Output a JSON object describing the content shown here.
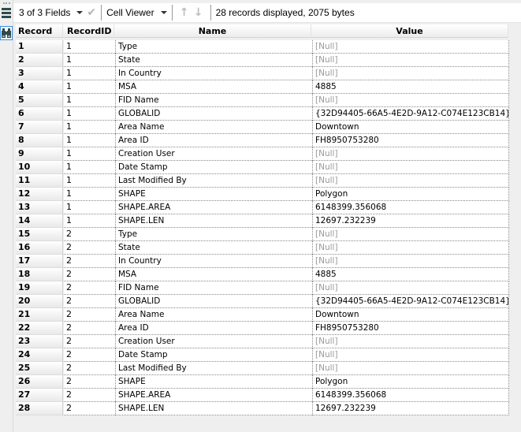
{
  "toolbar": {
    "fields_selector": "3 of 3 Fields",
    "viewer_selector": "Cell Viewer",
    "status": "28 records displayed, 2075 bytes"
  },
  "sidebar": {
    "icons": [
      "list-icon",
      "binoculars-icon"
    ]
  },
  "table": {
    "columns": [
      "Record #",
      "RecordID",
      "Name",
      "Value"
    ],
    "rows": [
      {
        "rec": "1",
        "id": "1",
        "name": "Type",
        "value": "[Null]",
        "null": true
      },
      {
        "rec": "2",
        "id": "1",
        "name": "State",
        "value": "[Null]",
        "null": true
      },
      {
        "rec": "3",
        "id": "1",
        "name": "In Country",
        "value": "[Null]",
        "null": true
      },
      {
        "rec": "4",
        "id": "1",
        "name": "MSA",
        "value": "4885",
        "null": false
      },
      {
        "rec": "5",
        "id": "1",
        "name": "FID Name",
        "value": "[Null]",
        "null": true
      },
      {
        "rec": "6",
        "id": "1",
        "name": "GLOBALID",
        "value": "{32D94405-66A5-4E2D-9A12-C074E123CB14}",
        "null": false
      },
      {
        "rec": "7",
        "id": "1",
        "name": "Area Name",
        "value": "Downtown",
        "null": false
      },
      {
        "rec": "8",
        "id": "1",
        "name": "Area ID",
        "value": "FH8950753280",
        "null": false
      },
      {
        "rec": "9",
        "id": "1",
        "name": "Creation User",
        "value": "[Null]",
        "null": true
      },
      {
        "rec": "10",
        "id": "1",
        "name": "Date Stamp",
        "value": "[Null]",
        "null": true
      },
      {
        "rec": "11",
        "id": "1",
        "name": "Last Modified By",
        "value": "[Null]",
        "null": true
      },
      {
        "rec": "12",
        "id": "1",
        "name": "SHAPE",
        "value": "Polygon",
        "null": false
      },
      {
        "rec": "13",
        "id": "1",
        "name": "SHAPE.AREA",
        "value": "6148399.356068",
        "null": false
      },
      {
        "rec": "14",
        "id": "1",
        "name": "SHAPE.LEN",
        "value": "12697.232239",
        "null": false
      },
      {
        "rec": "15",
        "id": "2",
        "name": "Type",
        "value": "[Null]",
        "null": true
      },
      {
        "rec": "16",
        "id": "2",
        "name": "State",
        "value": "[Null]",
        "null": true
      },
      {
        "rec": "17",
        "id": "2",
        "name": "In Country",
        "value": "[Null]",
        "null": true
      },
      {
        "rec": "18",
        "id": "2",
        "name": "MSA",
        "value": "4885",
        "null": false
      },
      {
        "rec": "19",
        "id": "2",
        "name": "FID Name",
        "value": "[Null]",
        "null": true
      },
      {
        "rec": "20",
        "id": "2",
        "name": "GLOBALID",
        "value": "{32D94405-66A5-4E2D-9A12-C074E123CB14}",
        "null": false
      },
      {
        "rec": "21",
        "id": "2",
        "name": "Area Name",
        "value": "Downtown",
        "null": false
      },
      {
        "rec": "22",
        "id": "2",
        "name": "Area ID",
        "value": "FH8950753280",
        "null": false
      },
      {
        "rec": "23",
        "id": "2",
        "name": "Creation User",
        "value": "[Null]",
        "null": true
      },
      {
        "rec": "24",
        "id": "2",
        "name": "Date Stamp",
        "value": "[Null]",
        "null": true
      },
      {
        "rec": "25",
        "id": "2",
        "name": "Last Modified By",
        "value": "[Null]",
        "null": true
      },
      {
        "rec": "26",
        "id": "2",
        "name": "SHAPE",
        "value": "Polygon",
        "null": false
      },
      {
        "rec": "27",
        "id": "2",
        "name": "SHAPE.AREA",
        "value": "6148399.356068",
        "null": false
      },
      {
        "rec": "28",
        "id": "2",
        "name": "SHAPE.LEN",
        "value": "12697.232239",
        "null": false
      }
    ]
  },
  "colors": {
    "null_text": "#9a9a9a",
    "selected_icon_border": "#3d8ee0",
    "background": "#efefef"
  }
}
